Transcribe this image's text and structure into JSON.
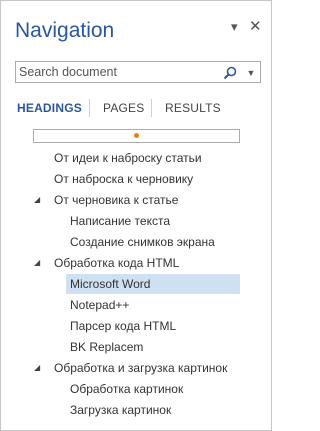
{
  "pane": {
    "title": "Navigation",
    "dropdown_icon": "▾",
    "close_icon": "✕"
  },
  "search": {
    "placeholder": "Search document",
    "value": ""
  },
  "tabs": [
    {
      "label": "HEADINGS",
      "active": true
    },
    {
      "label": "PAGES",
      "active": false
    },
    {
      "label": "RESULTS",
      "active": false
    }
  ],
  "colors": {
    "accent": "#2b579a",
    "selected_bg": "#cfe0f3",
    "progress_dot": "#e8820c"
  },
  "headings": [
    {
      "label": "От идеи к наброску статьи",
      "level": 1,
      "expanded": null,
      "selected": false
    },
    {
      "label": "От наброска к черновику",
      "level": 1,
      "expanded": null,
      "selected": false
    },
    {
      "label": "От черновика к статье",
      "level": 1,
      "expanded": true,
      "selected": false
    },
    {
      "label": "Написание текста",
      "level": 2,
      "expanded": null,
      "selected": false
    },
    {
      "label": "Создание снимков экрана",
      "level": 2,
      "expanded": null,
      "selected": false
    },
    {
      "label": "Обработка кода HTML",
      "level": 1,
      "expanded": true,
      "selected": false
    },
    {
      "label": "Microsoft Word",
      "level": 2,
      "expanded": null,
      "selected": true
    },
    {
      "label": "Notepad++",
      "level": 2,
      "expanded": null,
      "selected": false
    },
    {
      "label": "Парсер кода HTML",
      "level": 2,
      "expanded": null,
      "selected": false
    },
    {
      "label": "BK Replacem",
      "level": 2,
      "expanded": null,
      "selected": false
    },
    {
      "label": "Обработка и загрузка картинок",
      "level": 1,
      "expanded": true,
      "selected": false
    },
    {
      "label": "Обработка картинок",
      "level": 2,
      "expanded": null,
      "selected": false
    },
    {
      "label": "Загрузка картинок",
      "level": 2,
      "expanded": null,
      "selected": false
    }
  ]
}
